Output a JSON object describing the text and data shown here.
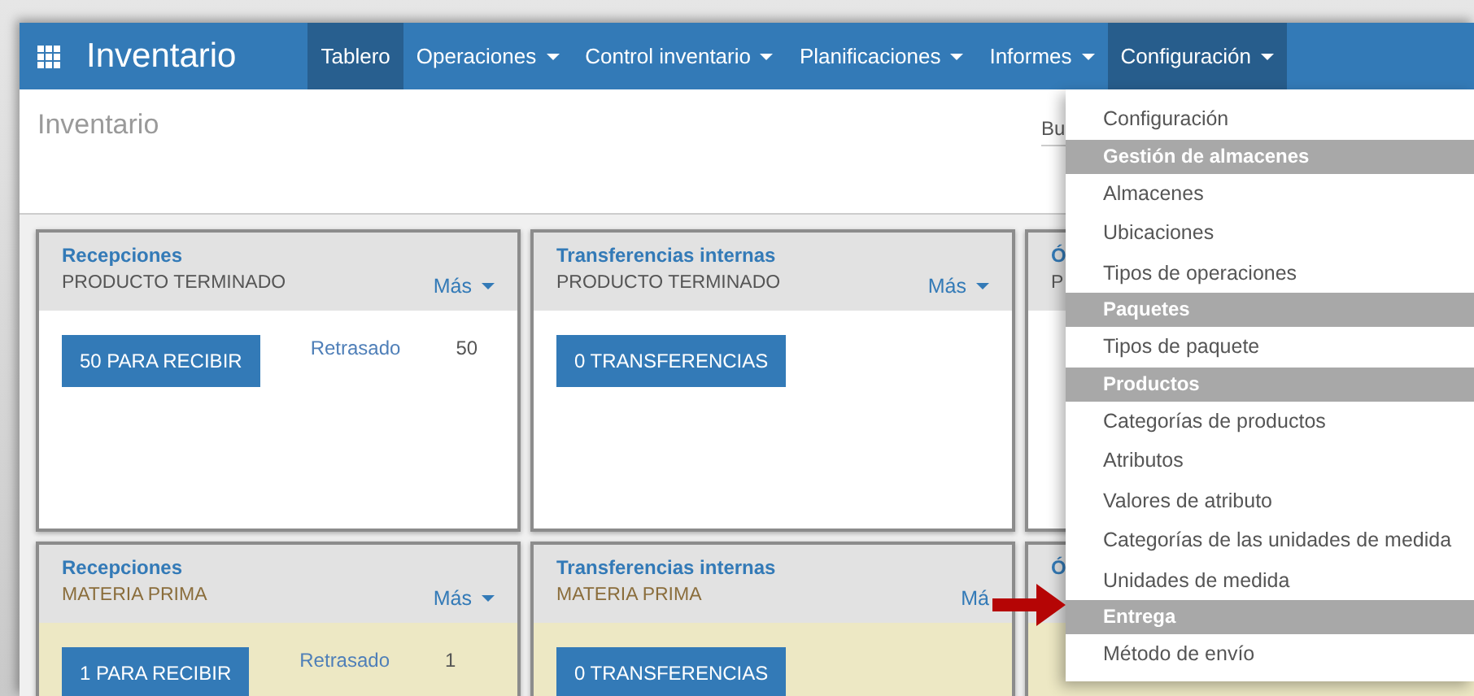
{
  "navbar": {
    "brand": "Inventario",
    "items": [
      {
        "label": "Tablero",
        "selected": true,
        "dropdown": false
      },
      {
        "label": "Operaciones",
        "selected": false,
        "dropdown": true
      },
      {
        "label": "Control inventario",
        "selected": false,
        "dropdown": true
      },
      {
        "label": "Planificaciones",
        "selected": false,
        "dropdown": true
      },
      {
        "label": "Informes",
        "selected": false,
        "dropdown": true
      },
      {
        "label": "Configuración",
        "selected": false,
        "dropdown": true,
        "expanded": true
      }
    ]
  },
  "control_panel": {
    "title": "Inventario",
    "search": {
      "placeholder": "Bu"
    }
  },
  "cards": [
    {
      "title": "Recepciones",
      "subtitle": "PRODUCTO TERMINADO",
      "more": "Más",
      "more_caret": true,
      "button": "50 PARA RECIBIR",
      "late": "Retrasado",
      "late_count": "50",
      "color": "#ffffff"
    },
    {
      "title": "Transferencias internas",
      "subtitle": "PRODUCTO TERMINADO",
      "more": "Más",
      "more_caret": true,
      "button": "0 TRANSFERENCIAS",
      "color": "#ffffff"
    },
    {
      "title": "Ó",
      "subtitle": "P",
      "color": "#ffffff"
    },
    {
      "title": "Recepciones",
      "subtitle": "MATERIA PRIMA",
      "more": "Más",
      "more_caret": true,
      "button": "1 PARA RECIBIR",
      "late": "Retrasado",
      "late_count": "1",
      "color": "#ede8c4"
    },
    {
      "title": "Transferencias internas",
      "subtitle": "MATERIA PRIMA",
      "more": "Má",
      "more_caret": false,
      "button": "0 TRANSFERENCIAS",
      "color": "#ede8c4"
    },
    {
      "title": "Ó",
      "color": "#ede8c4"
    }
  ],
  "dropdown_menu": [
    {
      "kind": "item",
      "label": "Configuración"
    },
    {
      "kind": "header",
      "label": "Gestión de almacenes"
    },
    {
      "kind": "item",
      "label": "Almacenes"
    },
    {
      "kind": "item",
      "label": "Ubicaciones"
    },
    {
      "kind": "item",
      "label": "Tipos de operaciones"
    },
    {
      "kind": "header",
      "label": "Paquetes"
    },
    {
      "kind": "item",
      "label": "Tipos de paquete"
    },
    {
      "kind": "header",
      "label": "Productos"
    },
    {
      "kind": "item",
      "label": "Categorías de productos"
    },
    {
      "kind": "item",
      "label": "Atributos"
    },
    {
      "kind": "item",
      "label": "Valores de atributo"
    },
    {
      "kind": "item",
      "label": "Categorías de las unidades de medida"
    },
    {
      "kind": "item",
      "label": "Unidades de medida"
    },
    {
      "kind": "header",
      "label": "Entrega"
    },
    {
      "kind": "item",
      "label": "Método de envío"
    }
  ]
}
